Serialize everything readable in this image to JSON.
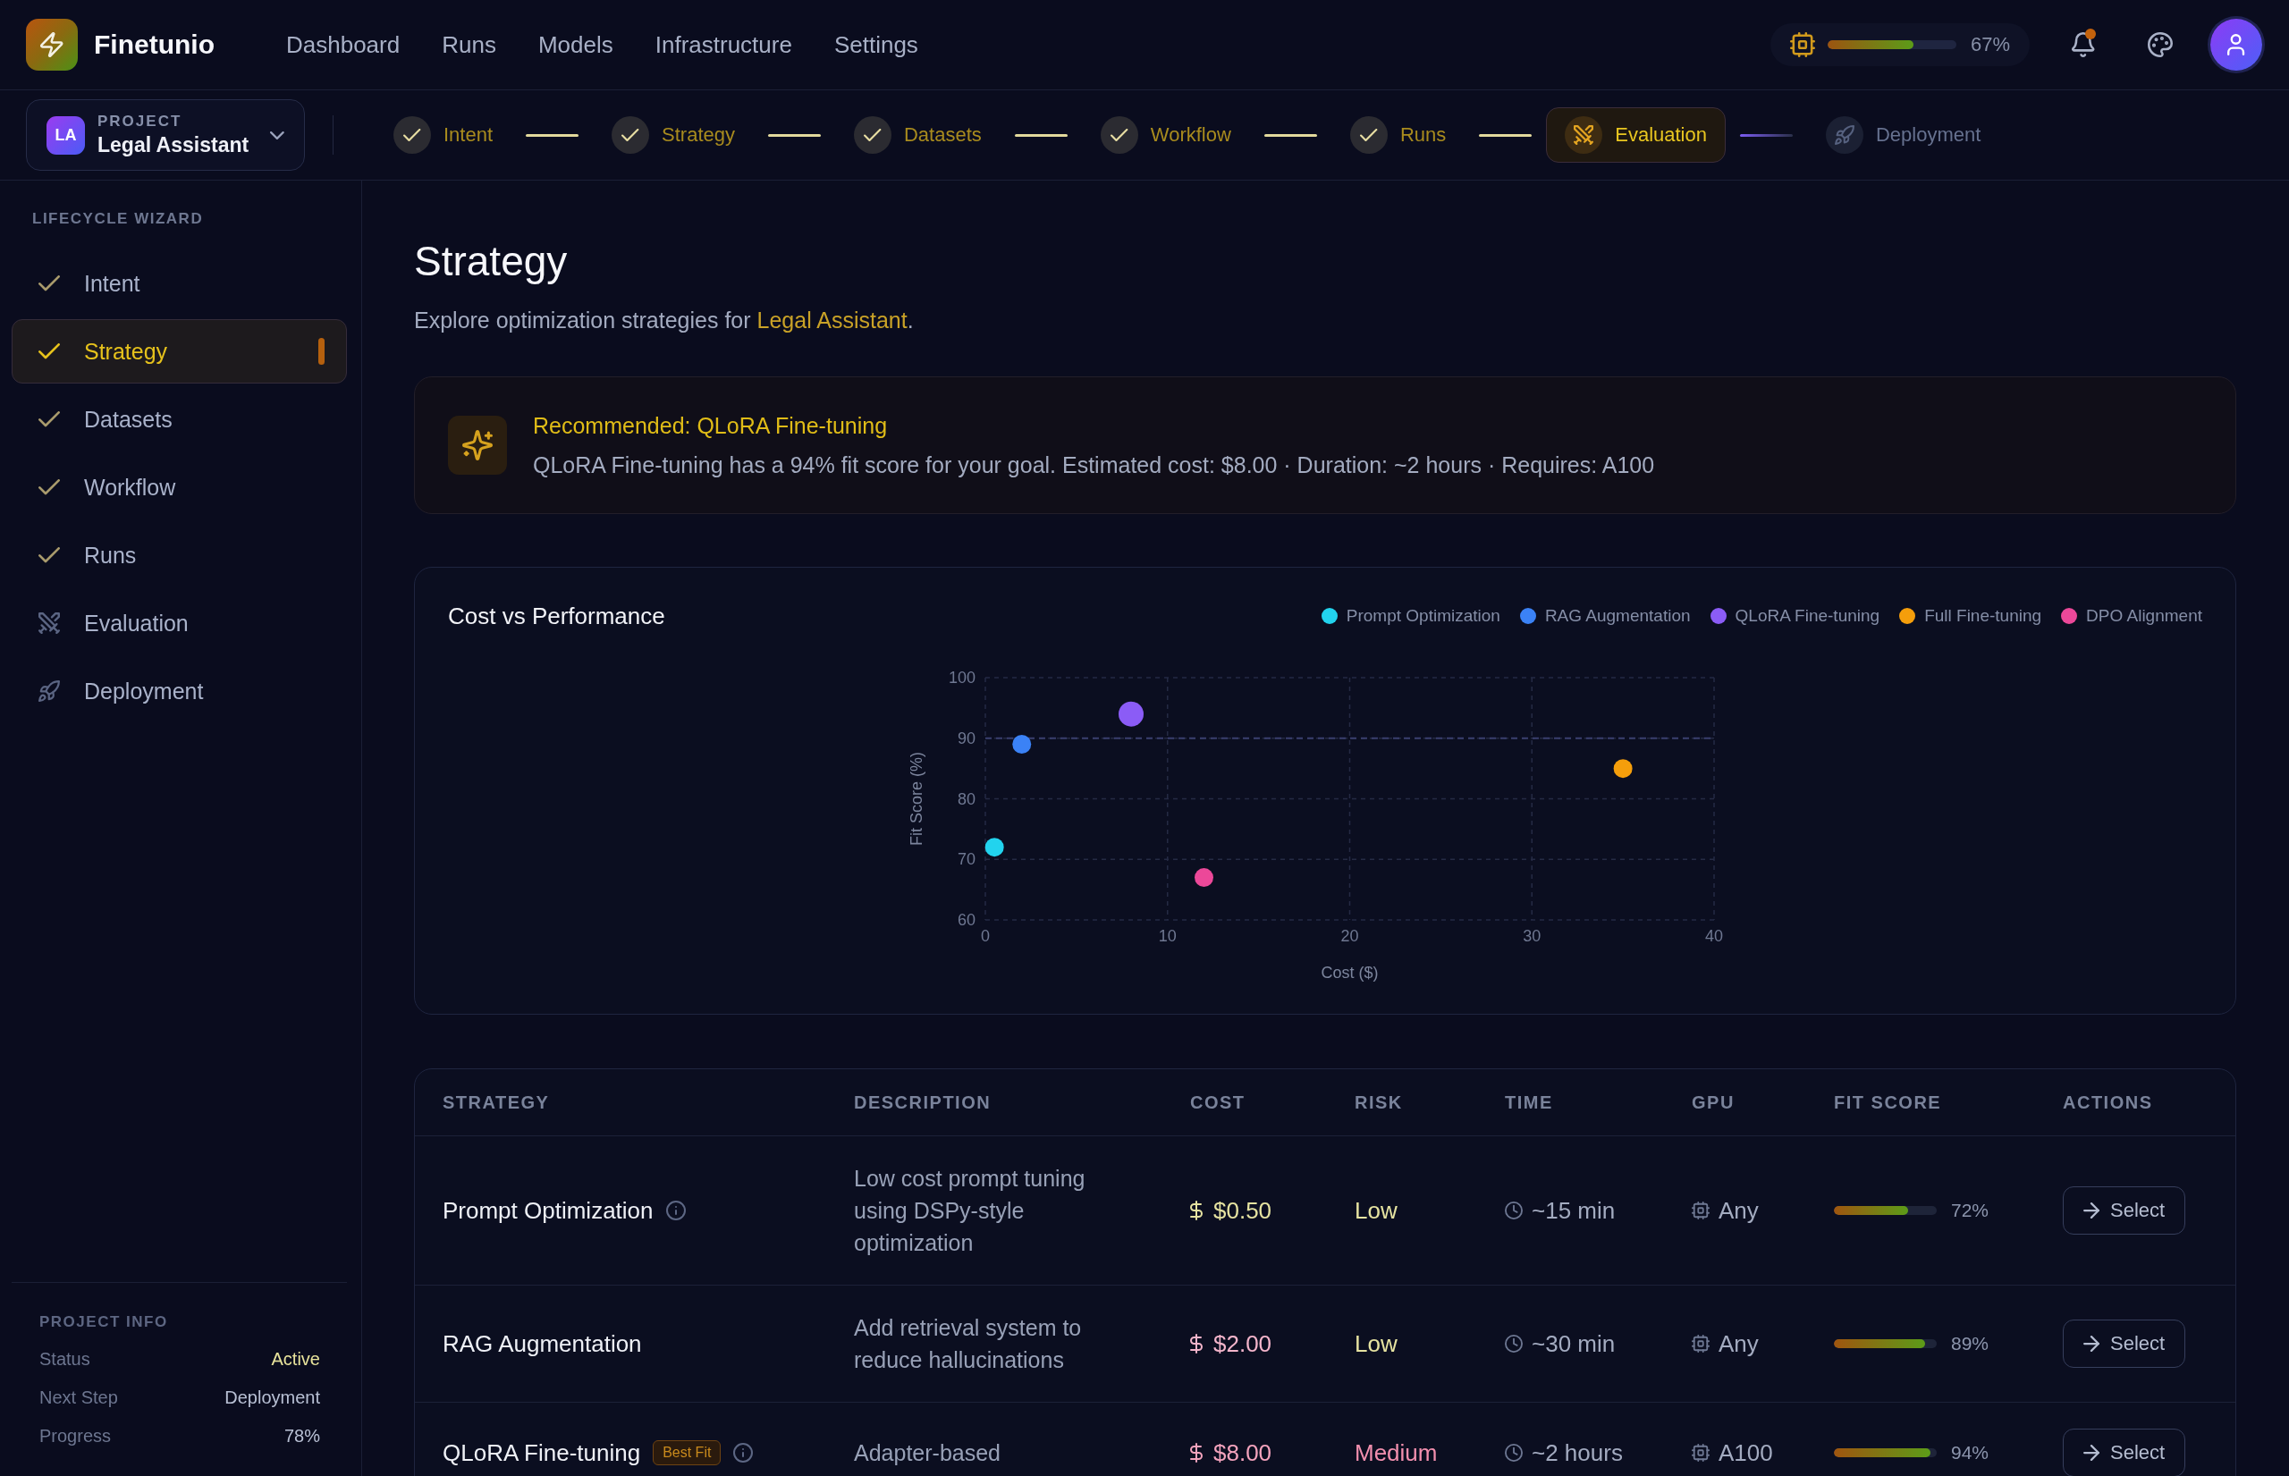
{
  "app": {
    "name": "Finetunio"
  },
  "nav": [
    "Dashboard",
    "Runs",
    "Models",
    "Infrastructure",
    "Settings"
  ],
  "resource_meter": {
    "level": 0.67,
    "reading": "67%"
  },
  "notifications": {
    "unread": true
  },
  "project": {
    "label": "PROJECT",
    "initials": "LA",
    "name": "Legal Assistant"
  },
  "stepper": [
    {
      "label": "Intent",
      "done": true,
      "selected": false
    },
    {
      "label": "Strategy",
      "done": true,
      "selected": false
    },
    {
      "label": "Datasets",
      "done": true,
      "selected": false
    },
    {
      "label": "Workflow",
      "done": true,
      "selected": false
    },
    {
      "label": "Runs",
      "done": true,
      "selected": false
    },
    {
      "label": "Evaluation",
      "done": false,
      "selected": true
    },
    {
      "label": "Deployment",
      "done": false,
      "selected": false
    }
  ],
  "sidebar": {
    "heading": "LIFECYCLE WIZARD",
    "items": [
      {
        "label": "Intent",
        "done": true,
        "selected": false
      },
      {
        "label": "Strategy",
        "done": true,
        "selected": true
      },
      {
        "label": "Datasets",
        "done": true,
        "selected": false
      },
      {
        "label": "Workflow",
        "done": true,
        "selected": false
      },
      {
        "label": "Runs",
        "done": true,
        "selected": false
      },
      {
        "label": "Evaluation",
        "done": false,
        "selected": false
      },
      {
        "label": "Deployment",
        "done": false,
        "selected": false
      }
    ]
  },
  "project_info": {
    "heading": "PROJECT INFO",
    "rows": [
      {
        "label": "Status",
        "value": "Active",
        "highlight": true
      },
      {
        "label": "Next Step",
        "value": "Deployment",
        "highlight": false
      },
      {
        "label": "Progress",
        "value": "78%",
        "highlight": false
      }
    ]
  },
  "page": {
    "title": "Strategy",
    "subtitle": {
      "text": "Explore optimization strategies for ",
      "link": "Legal Assistant",
      "end": "."
    }
  },
  "recommendation": {
    "title": "Recommended: QLoRA Fine-tuning",
    "body": "QLoRA Fine-tuning has a 94% fit score for your goal. Estimated cost: $8.00 · Duration: ~2 hours · Requires: A100"
  },
  "chart": {
    "title": "Cost vs Performance",
    "chart_data": {
      "type": "scatter",
      "xlabel": "Cost ($)",
      "ylabel": "Fit Score (%)",
      "xlim": [
        0,
        40
      ],
      "ylim": [
        60,
        100
      ],
      "xticks": [
        0,
        10,
        20,
        30,
        40
      ],
      "yticks": [
        60,
        70,
        80,
        90,
        100
      ],
      "grid": true,
      "series": [
        {
          "name": "Prompt Optimization",
          "color": "#22d3ee",
          "x": [
            0.5
          ],
          "values": [
            72
          ]
        },
        {
          "name": "RAG Augmentation",
          "color": "#3b82f6",
          "x": [
            2
          ],
          "values": [
            89
          ]
        },
        {
          "name": "QLoRA Fine-tuning",
          "color": "#8b5cf6",
          "x": [
            8
          ],
          "values": [
            94
          ]
        },
        {
          "name": "Full Fine-tuning",
          "color": "#f59e0b",
          "x": [
            35
          ],
          "values": [
            85
          ]
        },
        {
          "name": "DPO Alignment",
          "color": "#ec4899",
          "x": [
            12
          ],
          "values": [
            67
          ]
        }
      ],
      "ref_lines": [
        {
          "axis": "y",
          "value": 90
        }
      ]
    }
  },
  "table": {
    "columns": [
      "STRATEGY",
      "DESCRIPTION",
      "COST",
      "RISK",
      "TIME",
      "GPU",
      "FIT SCORE",
      "ACTIONS"
    ],
    "rows": [
      {
        "name": "Prompt Optimization",
        "info": true,
        "description": "Low cost prompt tuning using DSPy-style optimization",
        "cost": {
          "text": "$0.50",
          "color": "#e6e3a1"
        },
        "risk": {
          "text": "Low",
          "color": "#e6e3a1"
        },
        "time": "~15 min",
        "gpu": "Any",
        "fit": {
          "level": 0.72,
          "reading": "72%"
        },
        "action": "Select"
      },
      {
        "name": "RAG Augmentation",
        "info": false,
        "description": "Add retrieval system to reduce hallucinations",
        "cost": {
          "text": "$2.00",
          "color": "#f4b5cb"
        },
        "risk": {
          "text": "Low",
          "color": "#e6e3a1"
        },
        "time": "~30 min",
        "gpu": "Any",
        "fit": {
          "level": 0.89,
          "reading": "89%"
        },
        "action": "Select"
      },
      {
        "name": "QLoRA Fine-tuning",
        "badge": "Best Fit",
        "info": true,
        "description": "Adapter-based",
        "cost": {
          "text": "$8.00",
          "color": "#f4a3bd"
        },
        "risk": {
          "text": "Medium",
          "color": "#f28fae"
        },
        "time": "~2 hours",
        "gpu": "A100",
        "fit": {
          "level": 0.94,
          "reading": "94%"
        },
        "action": "Select"
      }
    ]
  }
}
